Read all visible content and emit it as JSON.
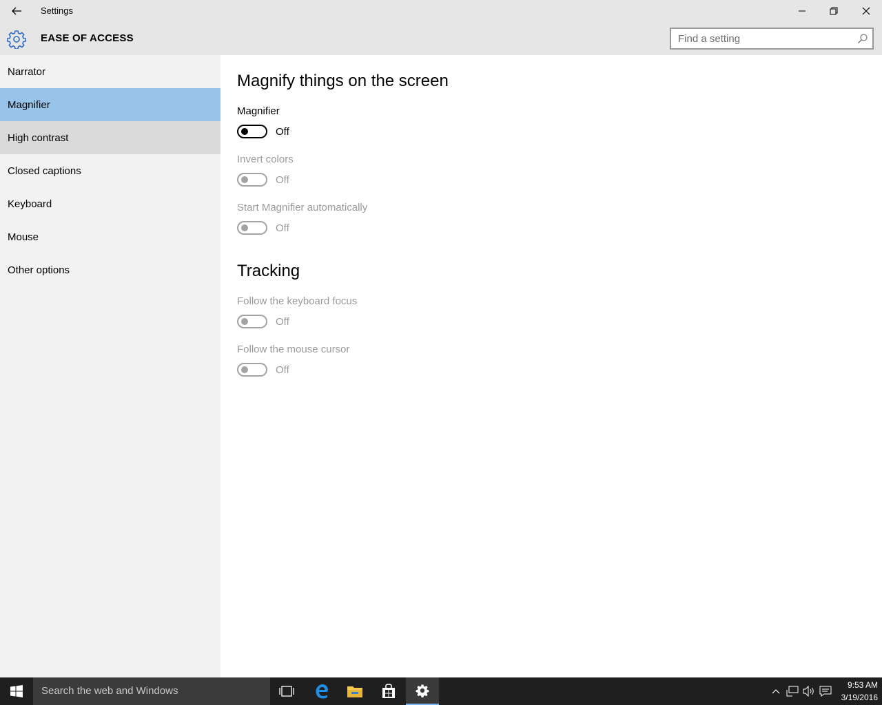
{
  "window": {
    "title": "Settings",
    "section_title": "EASE OF ACCESS"
  },
  "search": {
    "placeholder": "Find a setting"
  },
  "sidebar": {
    "items": [
      {
        "label": "Narrator"
      },
      {
        "label": "Magnifier",
        "selected": true
      },
      {
        "label": "High contrast"
      },
      {
        "label": "Closed captions"
      },
      {
        "label": "Keyboard"
      },
      {
        "label": "Mouse"
      },
      {
        "label": "Other options"
      }
    ]
  },
  "main": {
    "heading": "Magnify things on the screen",
    "settings": [
      {
        "label": "Magnifier",
        "state": "Off",
        "enabled": true
      },
      {
        "label": "Invert colors",
        "state": "Off",
        "enabled": false
      },
      {
        "label": "Start Magnifier automatically",
        "state": "Off",
        "enabled": false
      }
    ],
    "tracking_heading": "Tracking",
    "tracking": [
      {
        "label": "Follow the keyboard focus",
        "state": "Off",
        "enabled": false
      },
      {
        "label": "Follow the mouse cursor",
        "state": "Off",
        "enabled": false
      }
    ]
  },
  "taskbar": {
    "search_text": "Search the web and Windows",
    "time": "9:53 AM",
    "date": "3/19/2016"
  },
  "colors": {
    "accent": "#99c4ea",
    "gear_blue": "#2b6cc4"
  }
}
